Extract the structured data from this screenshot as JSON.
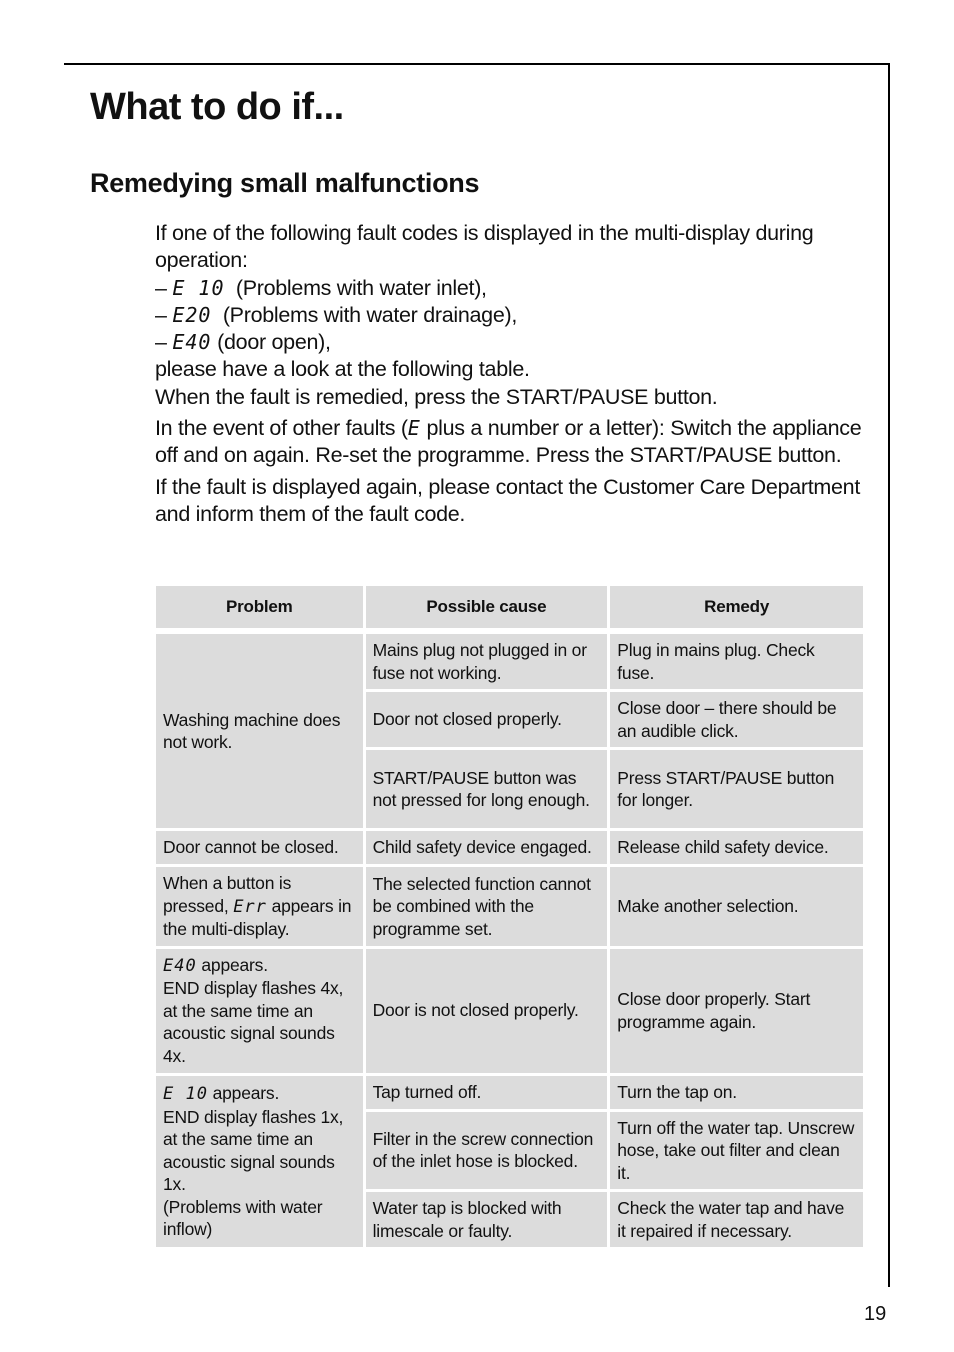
{
  "page": {
    "title": "What to do if...",
    "section_title": "Remedying small malfunctions",
    "page_number": "19"
  },
  "intro": {
    "line1": "If one of the following fault codes is displayed in the multi-display during operation:",
    "codes": [
      {
        "prefix": "– ",
        "code": "E 10",
        "text": "  (Problems with water inlet),"
      },
      {
        "prefix": "– ",
        "code": "E20",
        "text": "  (Problems with water drainage),"
      },
      {
        "prefix": "– ",
        "code": "E40",
        "text": " (door open),"
      }
    ],
    "line_table": "please have a look at the following table.",
    "line_remedied": "When the fault is remedied, press the START/PAUSE button.",
    "other_faults_before": "In the event of other faults (",
    "other_faults_code": "E",
    "other_faults_after": " plus a number or a letter): Switch the appliance off and on again. Re-set the programme. Press the START/PAUSE button.",
    "contact": "If the fault is displayed again, please contact the Customer Care Department and inform them of the fault code."
  },
  "table": {
    "headers": [
      "Problem",
      "Possible cause",
      "Remedy"
    ],
    "row1": {
      "problem": "Washing machine does not work.",
      "causes": [
        {
          "cause": "Mains plug not plugged in or fuse not working.",
          "remedy": "Plug in mains plug. Check fuse."
        },
        {
          "cause": "Door not closed properly.",
          "remedy": "Close door – there should be an audible click."
        },
        {
          "cause": "START/PAUSE button was not pressed for long enough.",
          "remedy": "Press START/PAUSE button for longer."
        }
      ]
    },
    "row2": {
      "problem": "Door cannot be closed.",
      "cause": "Child safety device engaged.",
      "remedy": "Release child safety device."
    },
    "row3": {
      "problem_before": "When a button is pressed, ",
      "problem_code": "Err",
      "problem_after": " appears in the multi-display.",
      "cause": "The selected function cannot be combined with the programme set.",
      "remedy": "Make another selection."
    },
    "row4": {
      "problem_code": "E40",
      "problem_after": " appears.",
      "problem_lines": [
        "END display flashes 4x, at the same time an acoustic signal sounds 4x."
      ],
      "cause": "Door is not closed properly.",
      "remedy": "Close door properly. Start programme again."
    },
    "row5": {
      "problem_code": "E 10",
      "problem_after": " appears.",
      "problem_lines": [
        "END display flashes 1x, at the same time an acoustic signal sounds 1x.",
        "(Problems with water inflow)"
      ],
      "causes": [
        {
          "cause": "Tap turned off.",
          "remedy": "Turn the tap on."
        },
        {
          "cause": "Filter in the screw connection of the inlet hose is blocked.",
          "remedy": "Turn off the water tap. Unscrew hose, take out filter and clean it."
        },
        {
          "cause": "Water tap is blocked with limescale or faulty.",
          "remedy": "Check the water tap and have it repaired if necessary."
        }
      ]
    }
  }
}
